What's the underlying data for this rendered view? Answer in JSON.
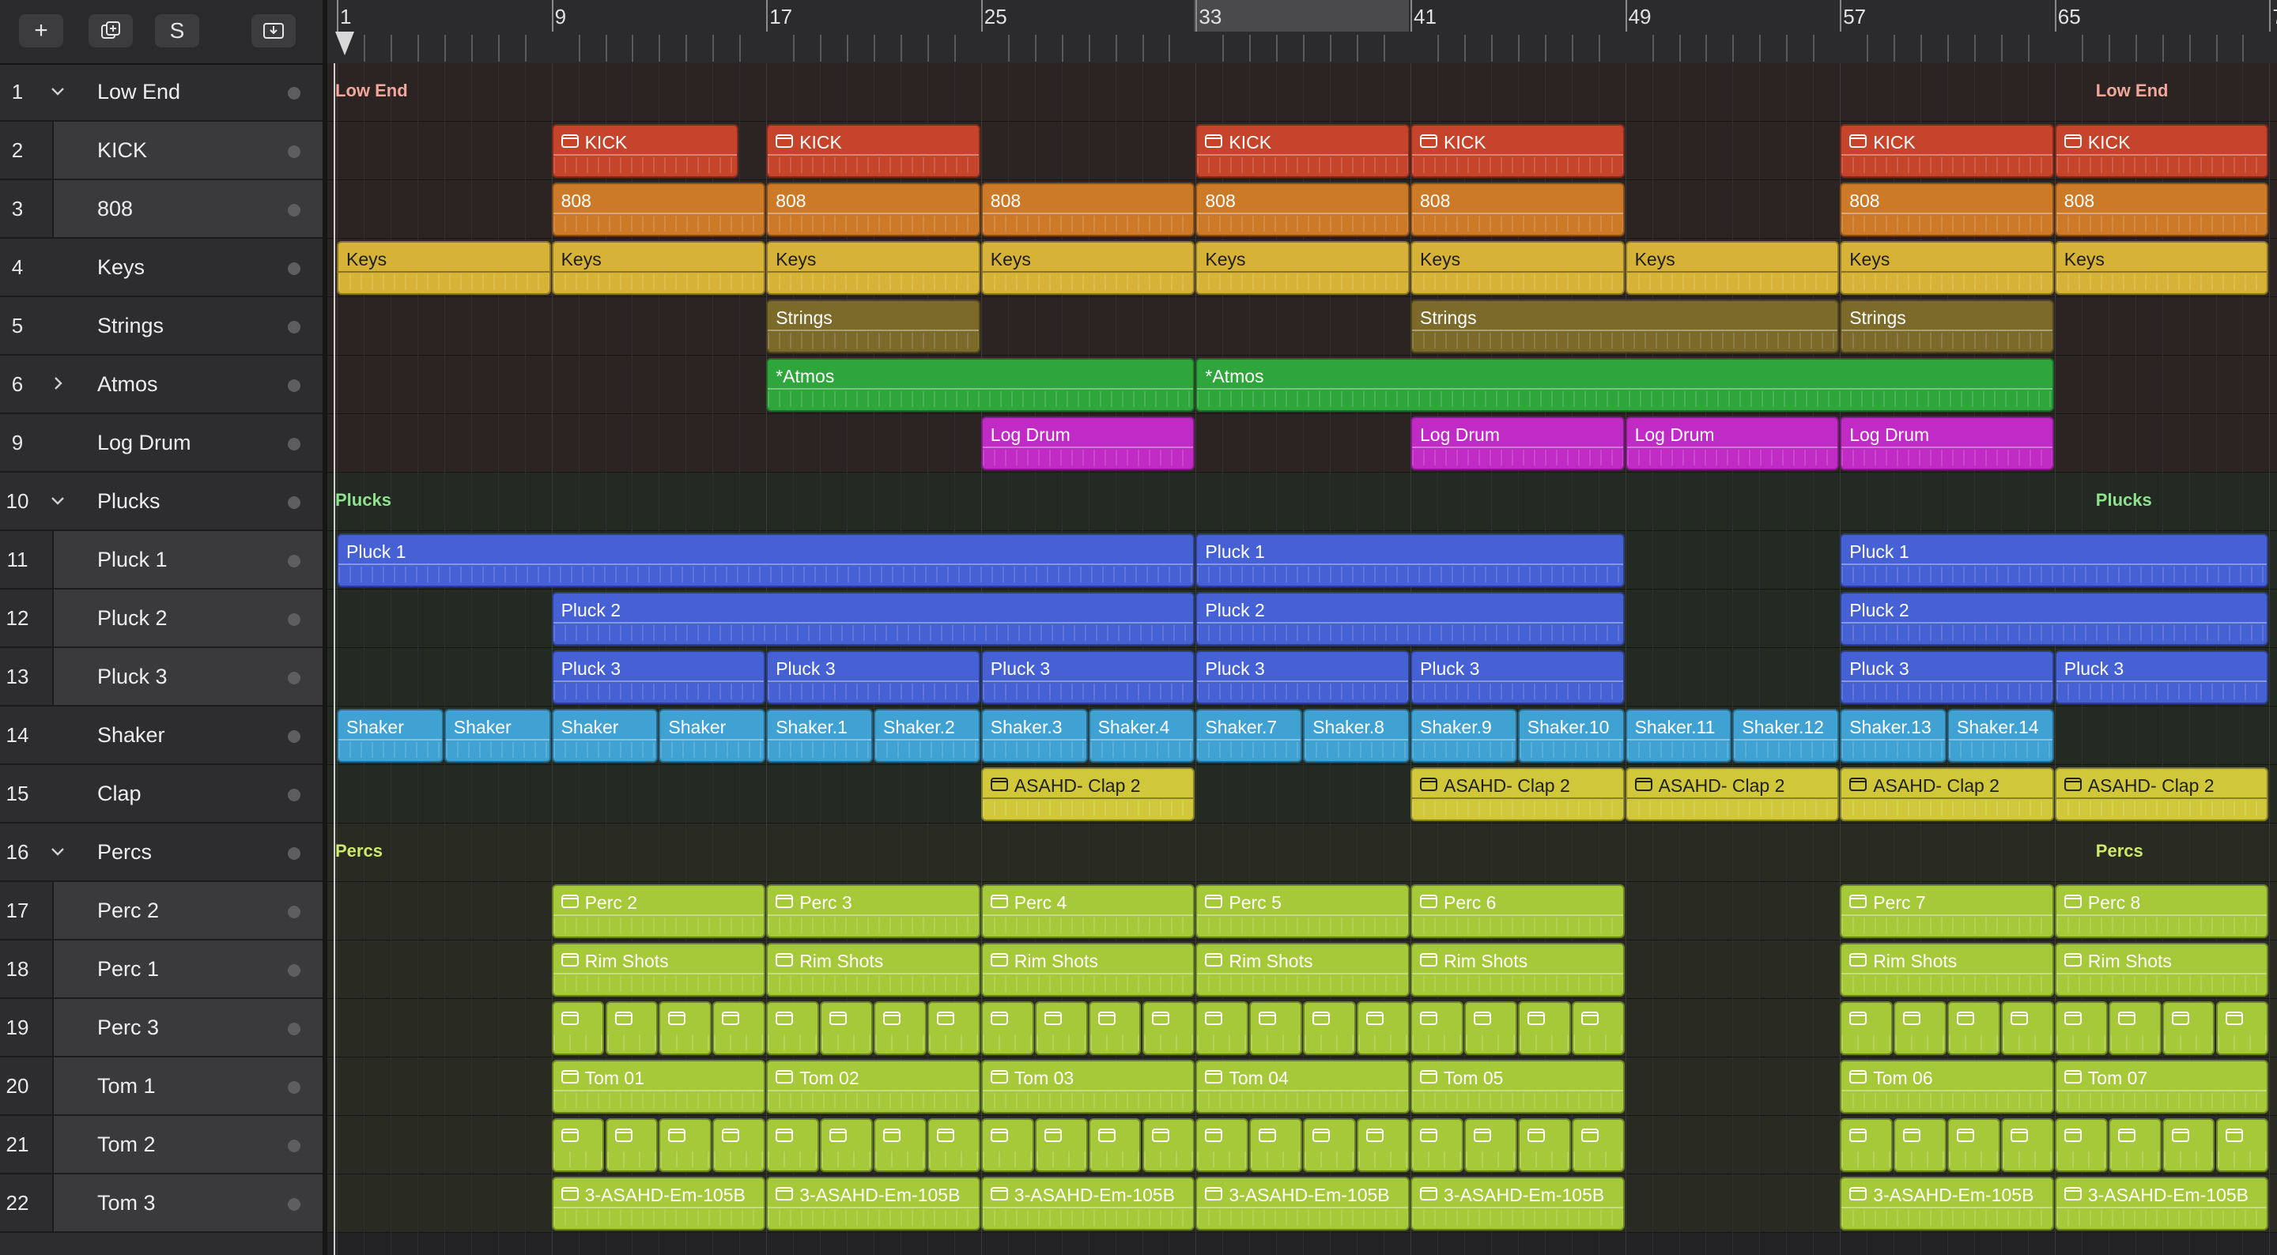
{
  "toolbar": {
    "buttons": [
      {
        "label": "+",
        "icon": "plus-icon"
      },
      {
        "label": "",
        "icon": "duplicate-track-icon"
      },
      {
        "label": "S",
        "icon": "solo-icon"
      },
      {
        "label": "",
        "icon": "download-tray-icon"
      }
    ]
  },
  "ruler": {
    "bars": [
      "1",
      "9",
      "17",
      "25",
      "33",
      "41",
      "49",
      "57",
      "65",
      "7"
    ]
  },
  "colors": {
    "lowend": "#f1a79a",
    "plucks": "#8fe18f",
    "percs": "#cde96a",
    "kick": "#c5442b",
    "808": "#cc7a28",
    "keys": "#d6b237",
    "strings": "#7b6a2a",
    "atmos": "#2ea63c",
    "logdrum": "#c02bc6",
    "pluck": "#4561d3",
    "shaker": "#3fa2d3",
    "clap": "#d0c73a",
    "perc": "#a6c93a"
  },
  "tracks": [
    {
      "num": "1",
      "name": "Low End",
      "disclosure": "v",
      "child": false
    },
    {
      "num": "2",
      "name": "KICK",
      "disclosure": "",
      "child": true
    },
    {
      "num": "3",
      "name": "808",
      "disclosure": "",
      "child": true
    },
    {
      "num": "4",
      "name": "Keys",
      "disclosure": "",
      "child": false
    },
    {
      "num": "5",
      "name": "Strings",
      "disclosure": "",
      "child": false
    },
    {
      "num": "6",
      "name": "Atmos",
      "disclosure": ">",
      "child": false
    },
    {
      "num": "9",
      "name": "Log Drum",
      "disclosure": "",
      "child": false
    },
    {
      "num": "10",
      "name": "Plucks",
      "disclosure": "v",
      "child": false
    },
    {
      "num": "11",
      "name": "Pluck 1",
      "disclosure": "",
      "child": true
    },
    {
      "num": "12",
      "name": "Pluck 2",
      "disclosure": "",
      "child": true
    },
    {
      "num": "13",
      "name": "Pluck 3",
      "disclosure": "",
      "child": true
    },
    {
      "num": "14",
      "name": "Shaker",
      "disclosure": "",
      "child": false
    },
    {
      "num": "15",
      "name": "Clap",
      "disclosure": "",
      "child": false
    },
    {
      "num": "16",
      "name": "Percs",
      "disclosure": "v",
      "child": false
    },
    {
      "num": "17",
      "name": "Perc 2",
      "disclosure": "",
      "child": true
    },
    {
      "num": "18",
      "name": "Perc 1",
      "disclosure": "",
      "child": true
    },
    {
      "num": "19",
      "name": "Perc 3",
      "disclosure": "",
      "child": true
    },
    {
      "num": "20",
      "name": "Tom 1",
      "disclosure": "",
      "child": true
    },
    {
      "num": "21",
      "name": "Tom 2",
      "disclosure": "",
      "child": true
    },
    {
      "num": "22",
      "name": "Tom 3",
      "disclosure": "",
      "child": true
    }
  ],
  "folder_labels": [
    {
      "text": "Low End",
      "row": 0,
      "bars": [
        1,
        65
      ],
      "color": "lowend"
    },
    {
      "text": "Plucks",
      "row": 7,
      "bars": [
        1,
        65
      ],
      "color": "plucks"
    },
    {
      "text": "Percs",
      "row": 13,
      "bars": [
        1,
        65
      ],
      "color": "percs"
    }
  ],
  "regions": [
    {
      "row": 1,
      "start": 9,
      "end": 16,
      "label": "KICK",
      "color": "kick",
      "folder": true
    },
    {
      "row": 1,
      "start": 17,
      "end": 25,
      "label": "KICK",
      "color": "kick",
      "folder": true
    },
    {
      "row": 1,
      "start": 33,
      "end": 41,
      "label": "KICK",
      "color": "kick",
      "folder": true
    },
    {
      "row": 1,
      "start": 41,
      "end": 49,
      "label": "KICK",
      "color": "kick",
      "folder": true
    },
    {
      "row": 1,
      "start": 57,
      "end": 65,
      "label": "KICK",
      "color": "kick",
      "folder": true
    },
    {
      "row": 1,
      "start": 65,
      "end": 73,
      "label": "KICK",
      "color": "kick",
      "folder": true
    },
    {
      "row": 2,
      "start": 9,
      "end": 17,
      "label": "808",
      "color": "808"
    },
    {
      "row": 2,
      "start": 17,
      "end": 25,
      "label": "808",
      "color": "808"
    },
    {
      "row": 2,
      "start": 25,
      "end": 33,
      "label": "808",
      "color": "808"
    },
    {
      "row": 2,
      "start": 33,
      "end": 41,
      "label": "808",
      "color": "808"
    },
    {
      "row": 2,
      "start": 41,
      "end": 49,
      "label": "808",
      "color": "808"
    },
    {
      "row": 2,
      "start": 57,
      "end": 65,
      "label": "808",
      "color": "808"
    },
    {
      "row": 2,
      "start": 65,
      "end": 73,
      "label": "808",
      "color": "808"
    },
    {
      "row": 3,
      "start": 1,
      "end": 9,
      "label": "Keys",
      "color": "keys",
      "dark": true
    },
    {
      "row": 3,
      "start": 9,
      "end": 17,
      "label": "Keys",
      "color": "keys",
      "dark": true
    },
    {
      "row": 3,
      "start": 17,
      "end": 25,
      "label": "Keys",
      "color": "keys",
      "dark": true
    },
    {
      "row": 3,
      "start": 25,
      "end": 33,
      "label": "Keys",
      "color": "keys",
      "dark": true
    },
    {
      "row": 3,
      "start": 33,
      "end": 41,
      "label": "Keys",
      "color": "keys",
      "dark": true
    },
    {
      "row": 3,
      "start": 41,
      "end": 49,
      "label": "Keys",
      "color": "keys",
      "dark": true
    },
    {
      "row": 3,
      "start": 49,
      "end": 57,
      "label": "Keys",
      "color": "keys",
      "dark": true
    },
    {
      "row": 3,
      "start": 57,
      "end": 65,
      "label": "Keys",
      "color": "keys",
      "dark": true
    },
    {
      "row": 3,
      "start": 65,
      "end": 73,
      "label": "Keys",
      "color": "keys",
      "dark": true
    },
    {
      "row": 4,
      "start": 17,
      "end": 25,
      "label": "Strings",
      "color": "strings"
    },
    {
      "row": 4,
      "start": 41,
      "end": 57,
      "label": "Strings",
      "color": "strings"
    },
    {
      "row": 4,
      "start": 57,
      "end": 65,
      "label": "Strings",
      "color": "strings"
    },
    {
      "row": 5,
      "start": 17,
      "end": 33,
      "label": "*Atmos",
      "color": "atmos"
    },
    {
      "row": 5,
      "start": 33,
      "end": 65,
      "label": "*Atmos",
      "color": "atmos"
    },
    {
      "row": 6,
      "start": 25,
      "end": 33,
      "label": "Log Drum",
      "color": "logdrum"
    },
    {
      "row": 6,
      "start": 41,
      "end": 49,
      "label": "Log Drum",
      "color": "logdrum"
    },
    {
      "row": 6,
      "start": 49,
      "end": 57,
      "label": "Log Drum",
      "color": "logdrum"
    },
    {
      "row": 6,
      "start": 57,
      "end": 65,
      "label": "Log Drum",
      "color": "logdrum"
    },
    {
      "row": 8,
      "start": 1,
      "end": 33,
      "label": "Pluck 1",
      "color": "pluck"
    },
    {
      "row": 8,
      "start": 33,
      "end": 49,
      "label": "Pluck 1",
      "color": "pluck"
    },
    {
      "row": 8,
      "start": 57,
      "end": 73,
      "label": "Pluck 1",
      "color": "pluck"
    },
    {
      "row": 9,
      "start": 9,
      "end": 33,
      "label": "Pluck 2",
      "color": "pluck"
    },
    {
      "row": 9,
      "start": 33,
      "end": 49,
      "label": "Pluck 2",
      "color": "pluck"
    },
    {
      "row": 9,
      "start": 57,
      "end": 73,
      "label": "Pluck 2",
      "color": "pluck"
    },
    {
      "row": 10,
      "start": 9,
      "end": 17,
      "label": "Pluck 3",
      "color": "pluck"
    },
    {
      "row": 10,
      "start": 17,
      "end": 25,
      "label": "Pluck 3",
      "color": "pluck"
    },
    {
      "row": 10,
      "start": 25,
      "end": 33,
      "label": "Pluck 3",
      "color": "pluck"
    },
    {
      "row": 10,
      "start": 33,
      "end": 41,
      "label": "Pluck 3",
      "color": "pluck"
    },
    {
      "row": 10,
      "start": 41,
      "end": 49,
      "label": "Pluck 3",
      "color": "pluck"
    },
    {
      "row": 10,
      "start": 57,
      "end": 65,
      "label": "Pluck 3",
      "color": "pluck"
    },
    {
      "row": 10,
      "start": 65,
      "end": 73,
      "label": "Pluck 3",
      "color": "pluck"
    },
    {
      "row": 11,
      "start": 1,
      "end": 5,
      "label": "Shaker",
      "color": "shaker"
    },
    {
      "row": 11,
      "start": 5,
      "end": 9,
      "label": "Shaker",
      "color": "shaker"
    },
    {
      "row": 11,
      "start": 9,
      "end": 13,
      "label": "Shaker",
      "color": "shaker"
    },
    {
      "row": 11,
      "start": 13,
      "end": 17,
      "label": "Shaker",
      "color": "shaker"
    },
    {
      "row": 11,
      "start": 17,
      "end": 21,
      "label": "Shaker.1",
      "color": "shaker"
    },
    {
      "row": 11,
      "start": 21,
      "end": 25,
      "label": "Shaker.2",
      "color": "shaker"
    },
    {
      "row": 11,
      "start": 25,
      "end": 29,
      "label": "Shaker.3",
      "color": "shaker"
    },
    {
      "row": 11,
      "start": 29,
      "end": 33,
      "label": "Shaker.4",
      "color": "shaker"
    },
    {
      "row": 11,
      "start": 33,
      "end": 37,
      "label": "Shaker.7",
      "color": "shaker"
    },
    {
      "row": 11,
      "start": 37,
      "end": 41,
      "label": "Shaker.8",
      "color": "shaker"
    },
    {
      "row": 11,
      "start": 41,
      "end": 45,
      "label": "Shaker.9",
      "color": "shaker"
    },
    {
      "row": 11,
      "start": 45,
      "end": 49,
      "label": "Shaker.10",
      "color": "shaker"
    },
    {
      "row": 11,
      "start": 49,
      "end": 53,
      "label": "Shaker.11",
      "color": "shaker"
    },
    {
      "row": 11,
      "start": 53,
      "end": 57,
      "label": "Shaker.12",
      "color": "shaker"
    },
    {
      "row": 11,
      "start": 57,
      "end": 61,
      "label": "Shaker.13",
      "color": "shaker"
    },
    {
      "row": 11,
      "start": 61,
      "end": 65,
      "label": "Shaker.14",
      "color": "shaker"
    },
    {
      "row": 12,
      "start": 25,
      "end": 33,
      "label": "ASAHD- Clap 2",
      "color": "clap",
      "dark": true,
      "folder": true
    },
    {
      "row": 12,
      "start": 41,
      "end": 49,
      "label": "ASAHD- Clap 2",
      "color": "clap",
      "dark": true,
      "folder": true
    },
    {
      "row": 12,
      "start": 49,
      "end": 57,
      "label": "ASAHD- Clap 2",
      "color": "clap",
      "dark": true,
      "folder": true
    },
    {
      "row": 12,
      "start": 57,
      "end": 65,
      "label": "ASAHD- Clap 2",
      "color": "clap",
      "dark": true,
      "folder": true
    },
    {
      "row": 12,
      "start": 65,
      "end": 73,
      "label": "ASAHD- Clap 2",
      "color": "clap",
      "dark": true,
      "folder": true
    },
    {
      "row": 14,
      "start": 9,
      "end": 17,
      "label": "Perc 2",
      "color": "perc",
      "folder": true
    },
    {
      "row": 14,
      "start": 17,
      "end": 25,
      "label": "Perc 3",
      "color": "perc",
      "folder": true
    },
    {
      "row": 14,
      "start": 25,
      "end": 33,
      "label": "Perc 4",
      "color": "perc",
      "folder": true
    },
    {
      "row": 14,
      "start": 33,
      "end": 41,
      "label": "Perc 5",
      "color": "perc",
      "folder": true
    },
    {
      "row": 14,
      "start": 41,
      "end": 49,
      "label": "Perc 6",
      "color": "perc",
      "folder": true
    },
    {
      "row": 14,
      "start": 57,
      "end": 65,
      "label": "Perc 7",
      "color": "perc",
      "folder": true
    },
    {
      "row": 14,
      "start": 65,
      "end": 73,
      "label": "Perc 8",
      "color": "perc",
      "folder": true
    },
    {
      "row": 15,
      "start": 9,
      "end": 17,
      "label": "Rim Shots",
      "color": "perc",
      "folder": true
    },
    {
      "row": 15,
      "start": 17,
      "end": 25,
      "label": "Rim Shots",
      "color": "perc",
      "folder": true
    },
    {
      "row": 15,
      "start": 25,
      "end": 33,
      "label": "Rim Shots",
      "color": "perc",
      "folder": true
    },
    {
      "row": 15,
      "start": 33,
      "end": 41,
      "label": "Rim Shots",
      "color": "perc",
      "folder": true
    },
    {
      "row": 15,
      "start": 41,
      "end": 49,
      "label": "Rim Shots",
      "color": "perc",
      "folder": true
    },
    {
      "row": 15,
      "start": 57,
      "end": 65,
      "label": "Rim Shots",
      "color": "perc",
      "folder": true
    },
    {
      "row": 15,
      "start": 65,
      "end": 73,
      "label": "Rim Shots",
      "color": "perc",
      "folder": true
    },
    {
      "row": 17,
      "start": 9,
      "end": 17,
      "label": "Tom 01",
      "color": "perc",
      "folder": true
    },
    {
      "row": 17,
      "start": 17,
      "end": 25,
      "label": "Tom 02",
      "color": "perc",
      "folder": true
    },
    {
      "row": 17,
      "start": 25,
      "end": 33,
      "label": "Tom 03",
      "color": "perc",
      "folder": true
    },
    {
      "row": 17,
      "start": 33,
      "end": 41,
      "label": "Tom 04",
      "color": "perc",
      "folder": true
    },
    {
      "row": 17,
      "start": 41,
      "end": 49,
      "label": "Tom 05",
      "color": "perc",
      "folder": true
    },
    {
      "row": 17,
      "start": 57,
      "end": 65,
      "label": "Tom 06",
      "color": "perc",
      "folder": true
    },
    {
      "row": 17,
      "start": 65,
      "end": 73,
      "label": "Tom 07",
      "color": "perc",
      "folder": true
    },
    {
      "row": 19,
      "start": 9,
      "end": 17,
      "label": "3-ASAHD-Em-105B",
      "color": "perc",
      "folder": true
    },
    {
      "row": 19,
      "start": 17,
      "end": 25,
      "label": "3-ASAHD-Em-105B",
      "color": "perc",
      "folder": true
    },
    {
      "row": 19,
      "start": 25,
      "end": 33,
      "label": "3-ASAHD-Em-105B",
      "color": "perc",
      "folder": true
    },
    {
      "row": 19,
      "start": 33,
      "end": 41,
      "label": "3-ASAHD-Em-105B",
      "color": "perc",
      "folder": true
    },
    {
      "row": 19,
      "start": 41,
      "end": 49,
      "label": "3-ASAHD-Em-105B",
      "color": "perc",
      "folder": true
    },
    {
      "row": 19,
      "start": 57,
      "end": 65,
      "label": "3-ASAHD-Em-105B",
      "color": "perc",
      "folder": true
    },
    {
      "row": 19,
      "start": 65,
      "end": 73,
      "label": "3-ASAHD-Em-105B",
      "color": "perc",
      "folder": true
    }
  ],
  "mini_region_rows": [
    16,
    18
  ],
  "mini_region_spans": [
    [
      9,
      49
    ],
    [
      57,
      73
    ]
  ]
}
